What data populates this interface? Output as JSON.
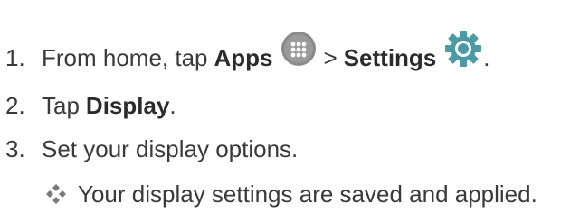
{
  "steps": [
    {
      "number": "1.",
      "text_before": "From home, tap",
      "bold1": "Apps",
      "separator": ">",
      "bold2": "Settings",
      "end": "."
    },
    {
      "number": "2.",
      "text_before": "Tap",
      "bold1": "Display",
      "end": "."
    },
    {
      "number": "3.",
      "text": "Set your display options."
    }
  ],
  "result": {
    "text": "Your display settings are saved and applied."
  },
  "icons": {
    "apps": "apps-icon",
    "settings": "settings-gear-icon",
    "bullet": "diamond-bullet-icon"
  },
  "colors": {
    "apps_icon": "#8a8a8a",
    "settings_icon": "#4b9aa6",
    "bullet_icon": "#7a7a7a",
    "text": "#3a3a3a"
  }
}
